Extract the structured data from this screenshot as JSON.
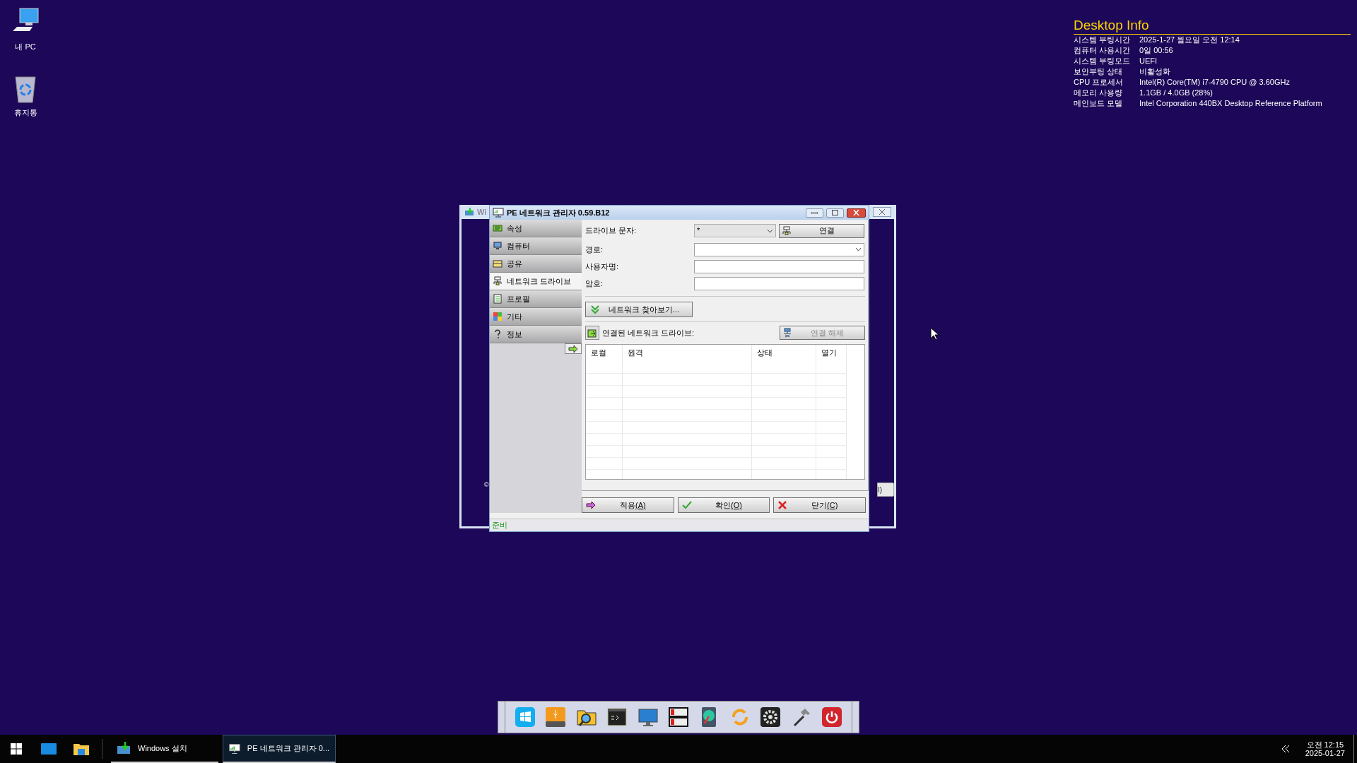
{
  "desktop_icons": [
    {
      "label": "내 PC",
      "kind": "pc"
    },
    {
      "label": "휴지통",
      "kind": "trash"
    }
  ],
  "desktop_info": {
    "title": "Desktop Info",
    "rows": [
      {
        "label": "시스템 부팅시간",
        "value": "2025-1-27 월요일 오전 12:14"
      },
      {
        "label": "컴퓨터 사용시간",
        "value": "0일 00:56"
      },
      {
        "label": "시스템 부팅모드",
        "value": "UEFI"
      },
      {
        "label": "보안부팅 상태",
        "value": "비활성화"
      },
      {
        "label": "CPU 프로세서",
        "value": "Intel(R) Core(TM) i7-4790 CPU @ 3.60GHz"
      },
      {
        "label": "메모리 사용량",
        "value": "1.1GB / 4.0GB (28%)"
      },
      {
        "label": "메인보드 모델",
        "value": "Intel Corporation 440BX Desktop Reference Platform"
      }
    ]
  },
  "background_window": {
    "title": "Wi",
    "footer_mark": "©",
    "button_fragment": "l)"
  },
  "dialog": {
    "title": "PE 네트워크 관리자 0.59.B12",
    "nav": [
      {
        "label": "속성",
        "kind": "properties",
        "selected": false
      },
      {
        "label": "컴퓨터",
        "kind": "computer",
        "selected": false
      },
      {
        "label": "공유",
        "kind": "share",
        "selected": false
      },
      {
        "label": "네트워크 드라이브",
        "kind": "network",
        "selected": true
      },
      {
        "label": "프로필",
        "kind": "profile",
        "selected": false
      },
      {
        "label": "기타",
        "kind": "other",
        "selected": false
      },
      {
        "label": "정보",
        "kind": "info",
        "selected": false
      }
    ],
    "drive_letter": {
      "label": "드라이브 문자:",
      "value": "*"
    },
    "connect_button": "연결",
    "path": {
      "label": "경로:"
    },
    "username": {
      "label": "사용자명:"
    },
    "password": {
      "label": "암호:"
    },
    "browse_button": "네트워크 찾아보기...",
    "connected_label": "연결된 네트워크 드라이브:",
    "disconnect_button": {
      "label": "연결 해제",
      "disabled": true
    },
    "table": {
      "columns": [
        "로컬",
        "원격",
        "상태",
        "열기"
      ]
    },
    "buttons": [
      {
        "kind": "apply",
        "label": "적용",
        "shortcut": "(A)"
      },
      {
        "kind": "ok",
        "label": "확인",
        "shortcut": "(O)"
      },
      {
        "kind": "close",
        "label": "닫기",
        "shortcut": "(C)"
      }
    ],
    "status": "준비"
  },
  "dock": {
    "items": [
      {
        "kind": "windows"
      },
      {
        "kind": "usb"
      },
      {
        "kind": "search-folder"
      },
      {
        "kind": "terminal"
      },
      {
        "kind": "monitor"
      },
      {
        "kind": "drives"
      },
      {
        "kind": "disk"
      },
      {
        "kind": "sync"
      },
      {
        "kind": "gear"
      },
      {
        "kind": "hammer"
      },
      {
        "kind": "power"
      }
    ]
  },
  "taskbar": {
    "tasks": [
      {
        "label": "Windows 설치",
        "kind": "setup",
        "selected": false
      },
      {
        "label": "PE 네트워크 관리자 0...",
        "kind": "network",
        "selected": true
      }
    ],
    "time": "오전 12:15",
    "date": "2025-01-27"
  }
}
